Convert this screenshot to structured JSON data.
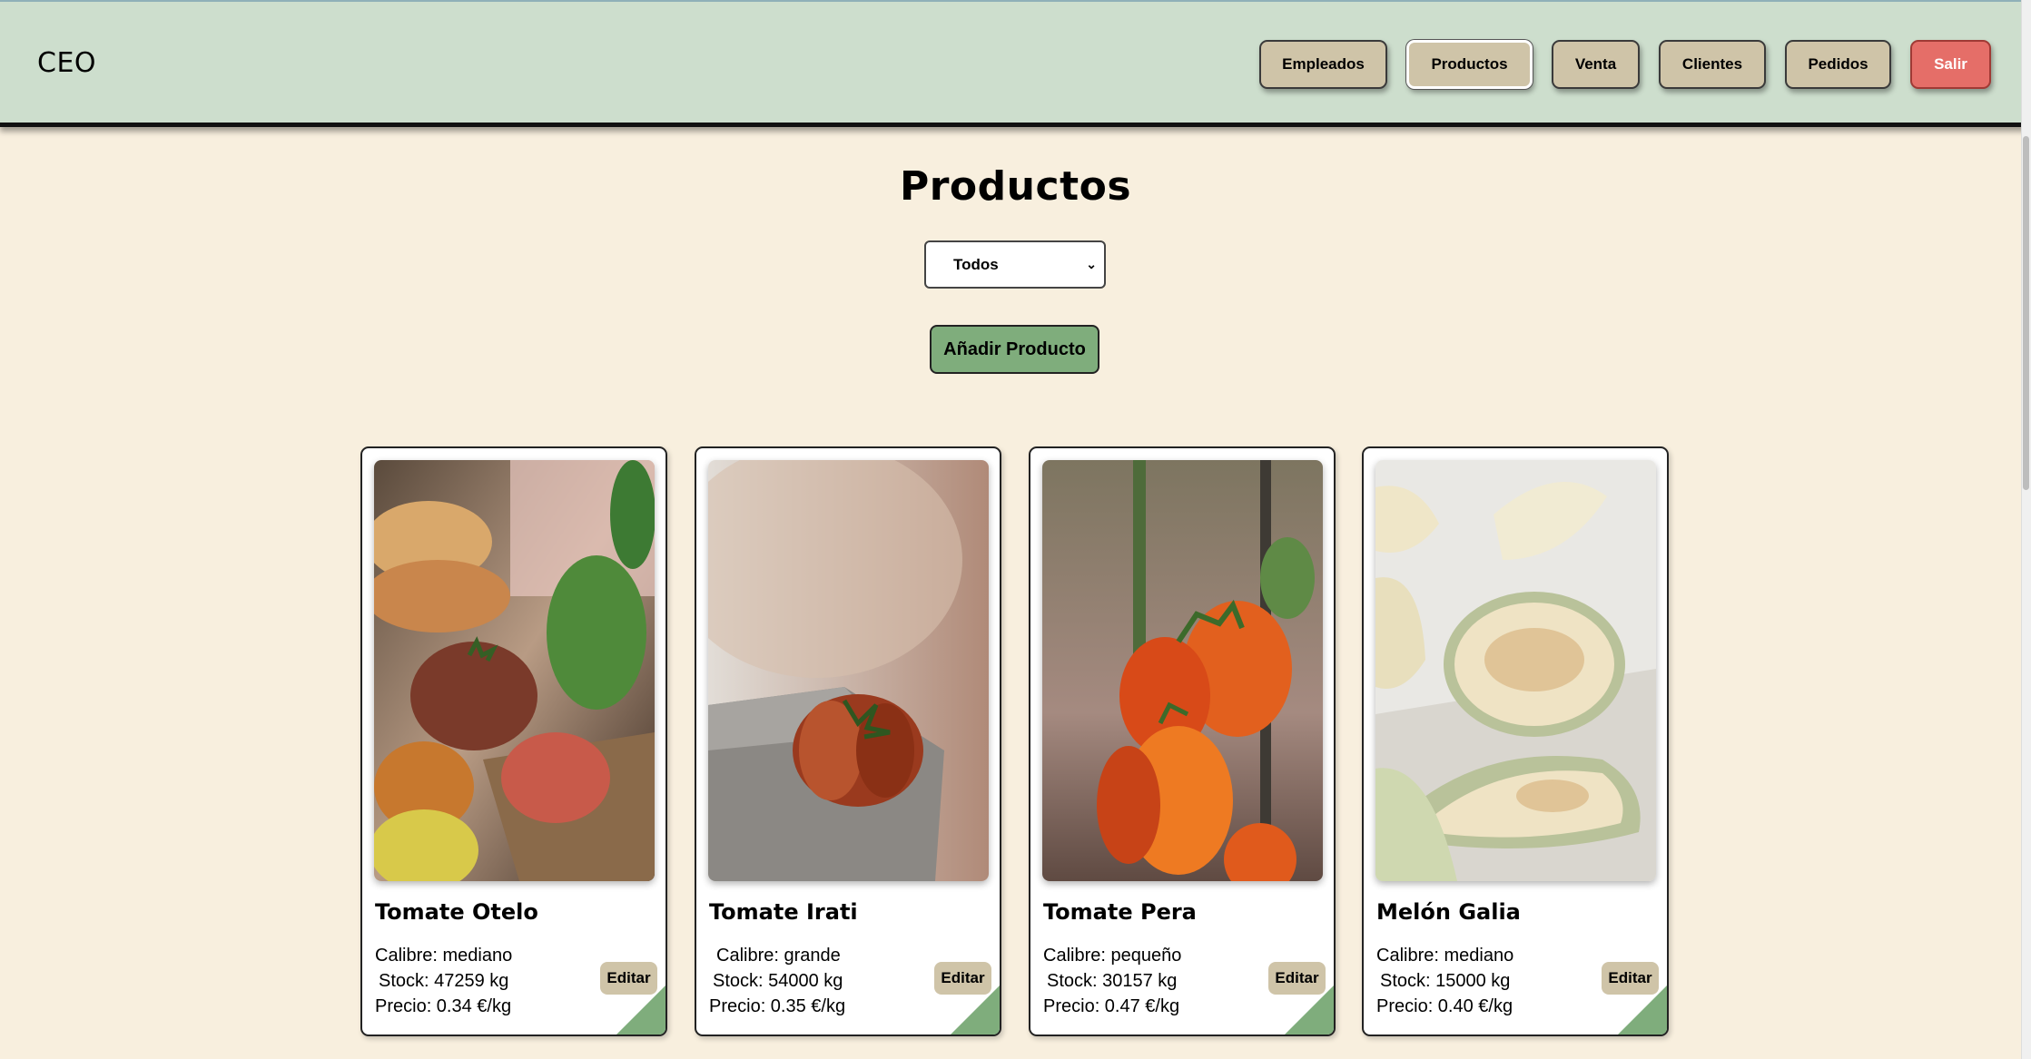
{
  "header": {
    "brand": "CEO",
    "nav": [
      {
        "label": "Empleados"
      },
      {
        "label": "Productos"
      },
      {
        "label": "Venta"
      },
      {
        "label": "Clientes"
      },
      {
        "label": "Pedidos"
      },
      {
        "label": "Salir"
      }
    ]
  },
  "main": {
    "title": "Productos",
    "filter": {
      "selected": "Todos"
    },
    "add_button": "Añadir Producto"
  },
  "products": [
    {
      "name": "Tomate Otelo",
      "calibre": "Calibre: mediano",
      "stock": "Stock: 47259 kg",
      "precio": "Precio: 0.34 €/kg",
      "edit": "Editar",
      "image": "heirloom-tomatoes-crate"
    },
    {
      "name": "Tomate Irati",
      "calibre": "Calibre: grande",
      "stock": "Stock: 54000 kg",
      "precio": "Precio: 0.35 €/kg",
      "edit": "Editar",
      "image": "single-ribbed-tomato"
    },
    {
      "name": "Tomate Pera",
      "calibre": "Calibre: pequeño",
      "stock": "Stock: 30157 kg",
      "precio": "Precio: 0.47 €/kg",
      "edit": "Editar",
      "image": "plum-tomatoes-on-vine"
    },
    {
      "name": "Melón Galia",
      "calibre": "Calibre: mediano",
      "stock": "Stock: 15000 kg",
      "precio": "Precio: 0.40 €/kg",
      "edit": "Editar",
      "image": "sliced-galia-melon"
    }
  ],
  "colors": {
    "header_bg": "#cddecd",
    "page_bg": "#f8efde",
    "nav_button": "#cfc4a8",
    "exit_button": "#e56e68",
    "accent_green": "#7fad7c"
  }
}
